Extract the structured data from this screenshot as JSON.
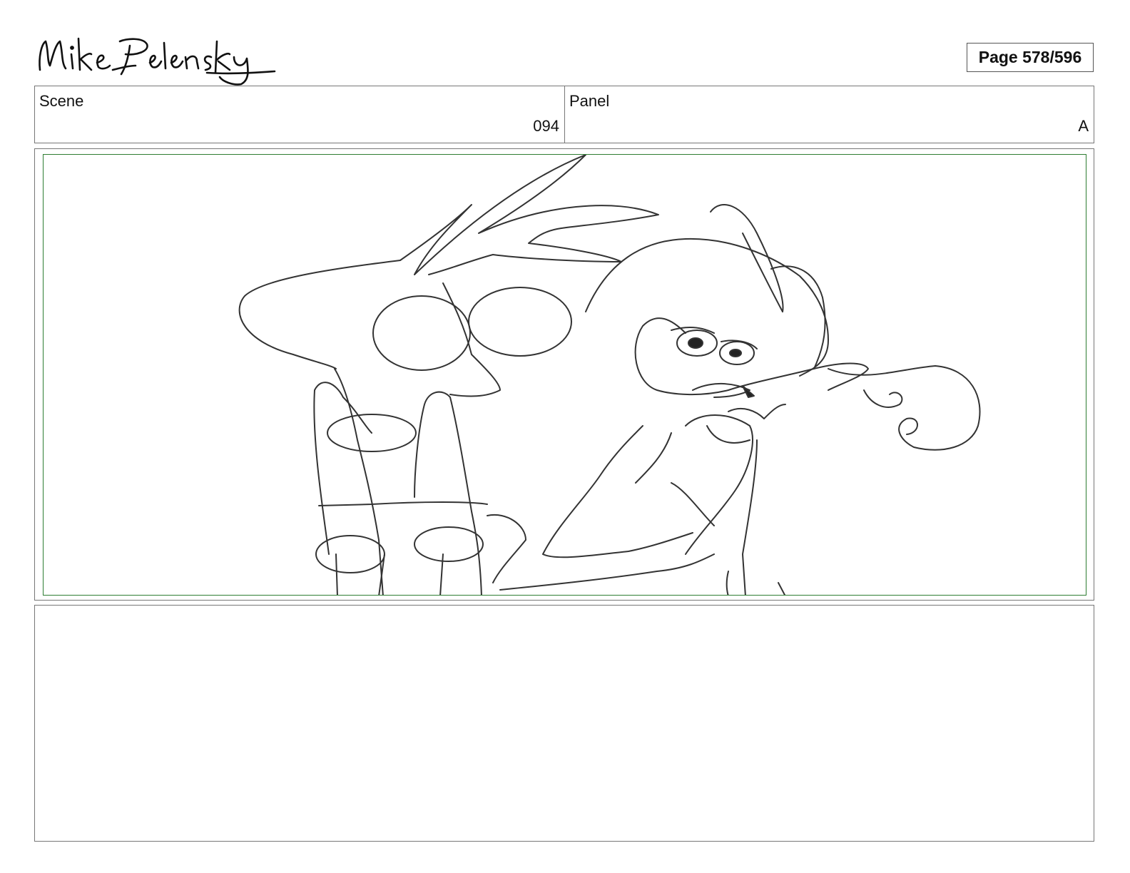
{
  "header": {
    "artist_signature": "Mike Pelensky",
    "page_label": "Page 578/596"
  },
  "scene": {
    "label": "Scene",
    "value": "094"
  },
  "panel": {
    "label": "Panel",
    "value": "A"
  },
  "frame": {
    "border_color": "#2e7d32",
    "icon": "rough-sketch-two-characters"
  },
  "notes": {
    "text": ""
  }
}
